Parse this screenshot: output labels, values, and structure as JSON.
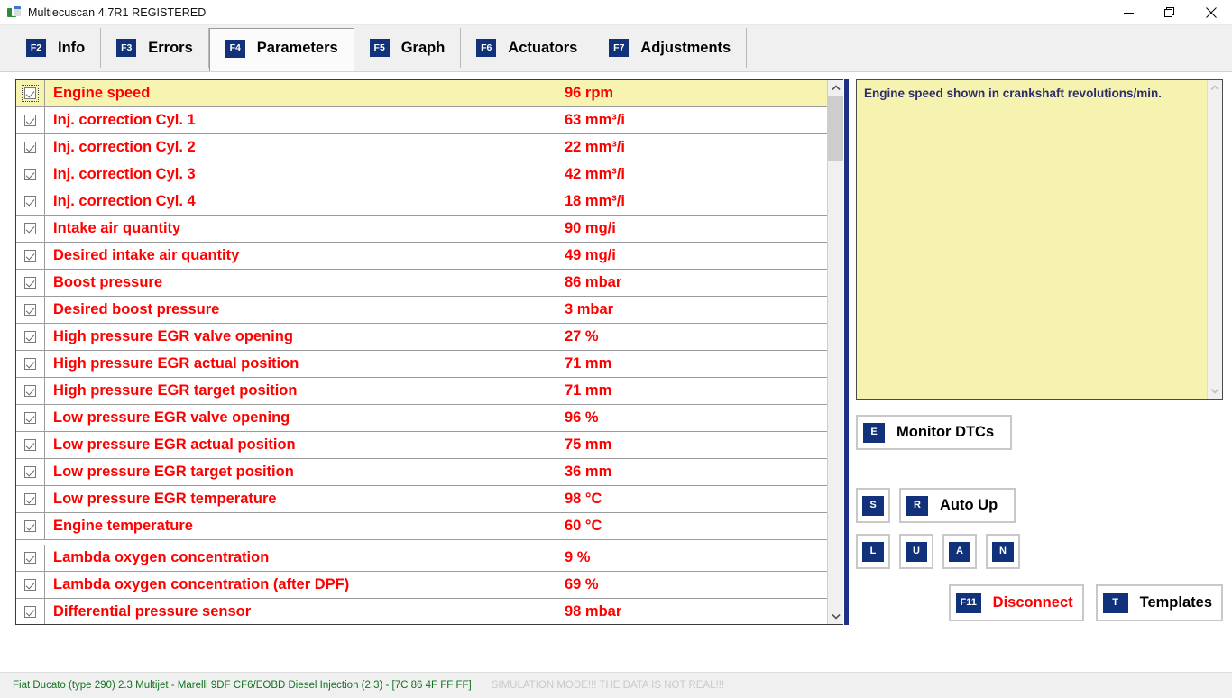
{
  "window": {
    "title": "Multiecuscan 4.7R1 REGISTERED",
    "icon": "app-logo-icon",
    "minimize": "–",
    "maximize": "❐",
    "close": "✕"
  },
  "tabs": [
    {
      "key": "F2",
      "label": "Info",
      "active": false
    },
    {
      "key": "F3",
      "label": "Errors",
      "active": false
    },
    {
      "key": "F4",
      "label": "Parameters",
      "active": true
    },
    {
      "key": "F5",
      "label": "Graph",
      "active": false
    },
    {
      "key": "F6",
      "label": "Actuators",
      "active": false
    },
    {
      "key": "F7",
      "label": "Adjustments",
      "active": false
    }
  ],
  "parameters": {
    "rows": [
      {
        "checked": true,
        "name": "Engine speed",
        "value": "96 rpm",
        "selected": true
      },
      {
        "checked": true,
        "name": "Inj. correction Cyl. 1",
        "value": "63 mm³/i",
        "selected": false
      },
      {
        "checked": true,
        "name": "Inj. correction Cyl. 2",
        "value": "22 mm³/i",
        "selected": false
      },
      {
        "checked": true,
        "name": "Inj. correction Cyl. 3",
        "value": "42 mm³/i",
        "selected": false
      },
      {
        "checked": true,
        "name": "Inj. correction Cyl. 4",
        "value": "18 mm³/i",
        "selected": false
      },
      {
        "checked": true,
        "name": "Intake air quantity",
        "value": "90 mg/i",
        "selected": false
      },
      {
        "checked": true,
        "name": "Desired intake air quantity",
        "value": "49 mg/i",
        "selected": false
      },
      {
        "checked": true,
        "name": "Boost pressure",
        "value": "86 mbar",
        "selected": false
      },
      {
        "checked": true,
        "name": "Desired boost pressure",
        "value": "3 mbar",
        "selected": false
      },
      {
        "checked": true,
        "name": "High pressure EGR valve opening",
        "value": "27 %",
        "selected": false
      },
      {
        "checked": true,
        "name": "High pressure EGR actual position",
        "value": "71 mm",
        "selected": false
      },
      {
        "checked": true,
        "name": "High pressure EGR target position",
        "value": "71 mm",
        "selected": false
      },
      {
        "checked": true,
        "name": "Low pressure EGR valve opening",
        "value": "96 %",
        "selected": false
      },
      {
        "checked": true,
        "name": "Low pressure EGR actual position",
        "value": "75 mm",
        "selected": false
      },
      {
        "checked": true,
        "name": "Low pressure EGR target position",
        "value": "36 mm",
        "selected": false
      },
      {
        "checked": true,
        "name": "Low pressure EGR temperature",
        "value": "98 °C",
        "selected": false
      },
      {
        "checked": true,
        "name": "Engine temperature",
        "value": "60 °C",
        "selected": false
      },
      {
        "checked": true,
        "name": "Lambda oxygen concentration",
        "value": "9 %",
        "selected": false,
        "gap": true
      },
      {
        "checked": true,
        "name": "Lambda oxygen concentration (after DPF)",
        "value": "69 %",
        "selected": false
      },
      {
        "checked": true,
        "name": "Differential pressure sensor",
        "value": "98 mbar",
        "selected": false
      }
    ]
  },
  "description": {
    "text": "Engine speed shown in crankshaft revolutions/min."
  },
  "side_buttons": {
    "monitor_dtcs": {
      "key": "E",
      "label": "Monitor DTCs"
    },
    "stop": {
      "key": "S",
      "label": ""
    },
    "auto_up": {
      "key": "R",
      "label": "Auto Up"
    },
    "log": {
      "key": "L",
      "label": ""
    },
    "up": {
      "key": "U",
      "label": ""
    },
    "add": {
      "key": "A",
      "label": ""
    },
    "none": {
      "key": "N",
      "label": ""
    },
    "disconnect": {
      "key": "F11",
      "label": "Disconnect"
    },
    "templates": {
      "key": "T",
      "label": "Templates"
    }
  },
  "statusbar": {
    "vehicle": "Fiat Ducato (type 290) 2.3 Multijet - Marelli 9DF CF6/EOBD Diesel Injection (2.3) - [7C 86 4F FF FF]",
    "simulation": "SIMULATION MODE!!! THE DATA IS NOT REAL!!!"
  },
  "colors": {
    "accent_blue": "#11317a",
    "param_red": "#ff0000",
    "highlight_yellow": "#f7f4b2",
    "desc_yellow": "#f6f3b0",
    "desc_text": "#2d2d6e",
    "status_green": "#13731f",
    "splitter_blue": "#1f2f87"
  }
}
